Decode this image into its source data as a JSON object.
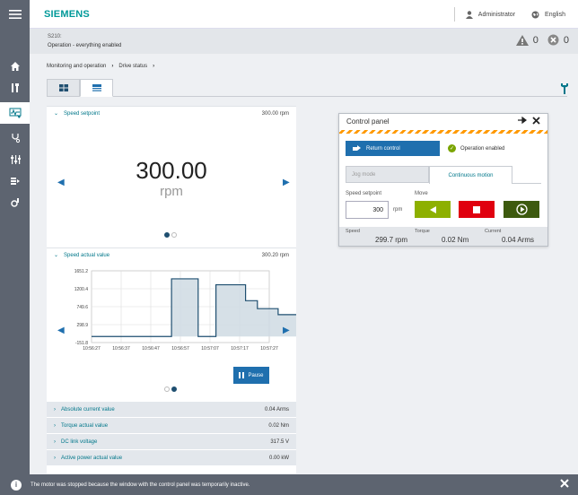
{
  "header": {
    "logo": "SIEMENS",
    "user": "Administrator",
    "language": "English"
  },
  "status": {
    "device": "S210:",
    "state": "Operation - everything enabled",
    "warnings": "0",
    "errors": "0"
  },
  "breadcrumb": [
    "Monitoring and operation",
    "Drive status"
  ],
  "speed_setpoint": {
    "label": "Speed setpoint",
    "value": "300.00 rpm",
    "big_value": "300.00",
    "unit": "rpm"
  },
  "speed_actual": {
    "label": "Speed actual value",
    "value": "300.20 rpm",
    "pause_label": "Pause"
  },
  "chart_data": {
    "type": "line",
    "x": [
      "10:56:27",
      "10:56:37",
      "10:56:47",
      "10:56:57",
      "10:57:07",
      "10:57:17",
      "10:57:27"
    ],
    "yticks": [
      "1651.2",
      "1200.4",
      "749.6",
      "298.9",
      "-151.8"
    ],
    "ylim": [
      -151.8,
      1651.2
    ],
    "series": [
      {
        "name": "",
        "points": [
          [
            0,
            0
          ],
          [
            2.7,
            0
          ],
          [
            2.7,
            1450
          ],
          [
            3.6,
            1450
          ],
          [
            3.6,
            0
          ],
          [
            4.2,
            0
          ],
          [
            4.2,
            1300
          ],
          [
            5.2,
            1300
          ],
          [
            5.2,
            900
          ],
          [
            5.6,
            900
          ],
          [
            5.6,
            700
          ],
          [
            6.3,
            700
          ],
          [
            6.3,
            550
          ],
          [
            7.0,
            550
          ],
          [
            7.0,
            300
          ],
          [
            7.3,
            300
          ]
        ]
      }
    ],
    "grid": true
  },
  "rows": [
    {
      "label": "Absolute current value",
      "value": "0.04 Arms"
    },
    {
      "label": "Torque actual value",
      "value": "0.02 Nm"
    },
    {
      "label": "DC link voltage",
      "value": "317.5 V"
    },
    {
      "label": "Active power actual value",
      "value": "0.00 kW"
    }
  ],
  "control_panel": {
    "title": "Control panel",
    "return_control": "Return control",
    "operation_enabled": "Operation enabled",
    "tab_jog": "Jog mode",
    "tab_continuous": "Continuous motion",
    "setpoint_label": "Speed setpoint",
    "setpoint_value": "300",
    "setpoint_unit": "rpm",
    "move_label": "Move",
    "speed_label": "Speed",
    "speed_value": "299.7 rpm",
    "torque_label": "Torque",
    "torque_value": "0.02 Nm",
    "current_label": "Current",
    "current_value": "0.04 Arms",
    "colors": {
      "move_left": "#8db000",
      "stop": "#e0000f",
      "move_right": "#3d5a0f"
    }
  },
  "message": "The motor was stopped because the window with the control panel was temporarily inactive."
}
